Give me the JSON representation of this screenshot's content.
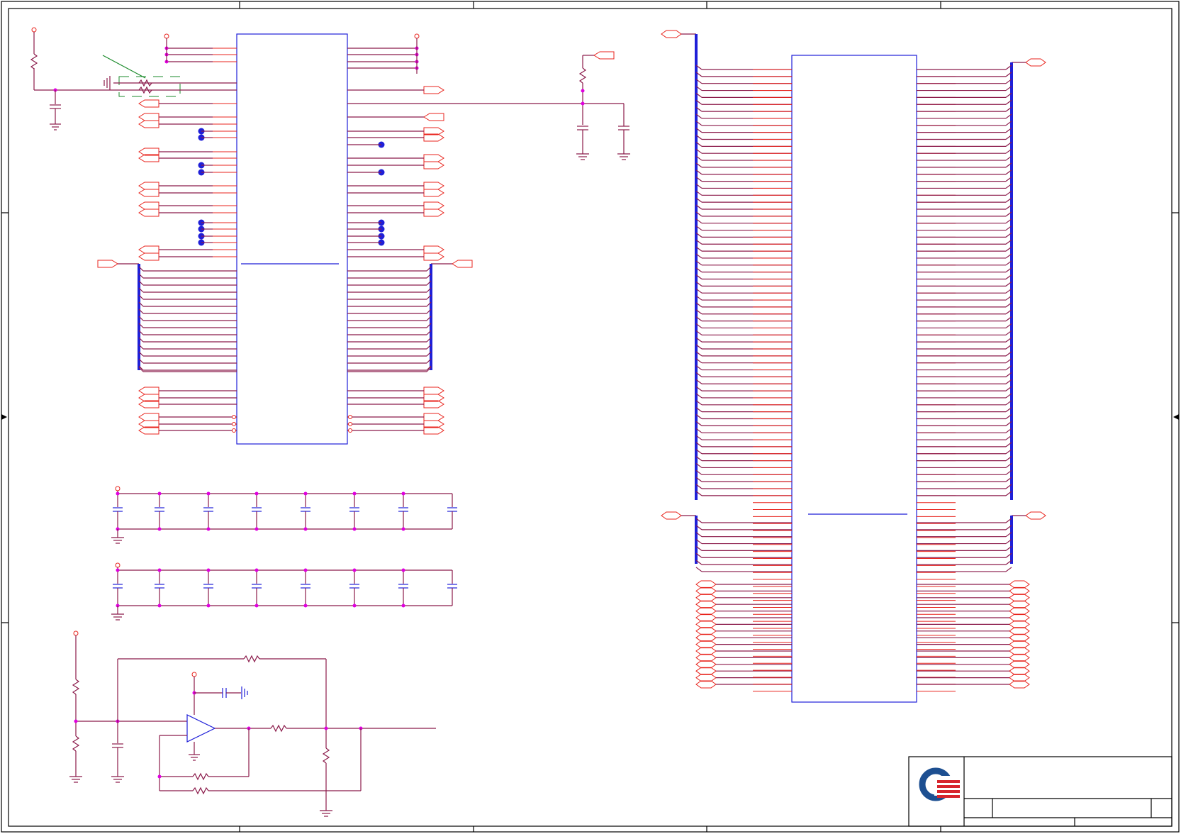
{
  "sheet": {
    "border_color": "#000000",
    "ic_color": "#1f1fd8",
    "pin_color": "#e8231c",
    "wire_color": "#8b1a4a",
    "junction_color": "#e000e0"
  },
  "logo": {
    "icon": "company-logo-icon",
    "colors": [
      "#1d4f91",
      "#d7262e"
    ]
  }
}
